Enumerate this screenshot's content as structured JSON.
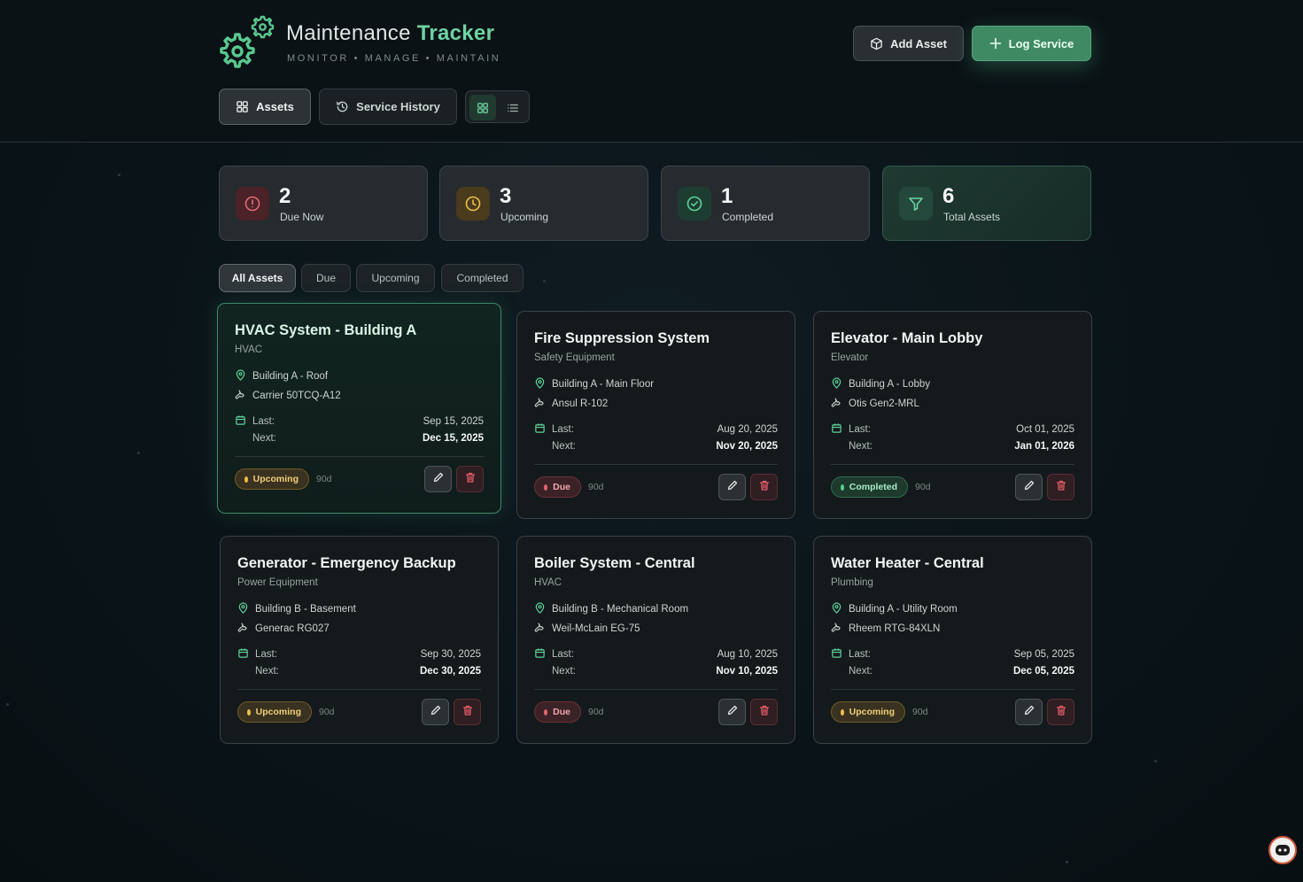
{
  "header": {
    "title_main": "Maintenance",
    "title_accent": "Tracker",
    "subtitle": "MONITOR • MANAGE • MAINTAIN",
    "add_asset_label": "Add Asset",
    "log_service_label": "Log Service"
  },
  "nav": {
    "assets_label": "Assets",
    "history_label": "Service History"
  },
  "stats": {
    "due_now": {
      "value": "2",
      "label": "Due Now"
    },
    "upcoming": {
      "value": "3",
      "label": "Upcoming"
    },
    "completed": {
      "value": "1",
      "label": "Completed"
    },
    "total": {
      "value": "6",
      "label": "Total Assets"
    }
  },
  "filters": [
    "All Assets",
    "Due",
    "Upcoming",
    "Completed"
  ],
  "labels": {
    "last": "Last:",
    "next": "Next:"
  },
  "assets": [
    {
      "name": "HVAC System - Building A",
      "category": "HVAC",
      "location": "Building A - Roof",
      "model": "Carrier 50TCQ-A12",
      "last": "Sep 15, 2025",
      "next": "Dec 15, 2025",
      "status": "Upcoming",
      "interval": "90d"
    },
    {
      "name": "Fire Suppression System",
      "category": "Safety Equipment",
      "location": "Building A - Main Floor",
      "model": "Ansul R-102",
      "last": "Aug 20, 2025",
      "next": "Nov 20, 2025",
      "status": "Due",
      "interval": "90d"
    },
    {
      "name": "Elevator - Main Lobby",
      "category": "Elevator",
      "location": "Building A - Lobby",
      "model": "Otis Gen2-MRL",
      "last": "Oct 01, 2025",
      "next": "Jan 01, 2026",
      "status": "Completed",
      "interval": "90d"
    },
    {
      "name": "Generator - Emergency Backup",
      "category": "Power Equipment",
      "location": "Building B - Basement",
      "model": "Generac RG027",
      "last": "Sep 30, 2025",
      "next": "Dec 30, 2025",
      "status": "Upcoming",
      "interval": "90d"
    },
    {
      "name": "Boiler System - Central",
      "category": "HVAC",
      "location": "Building B - Mechanical Room",
      "model": "Weil-McLain EG-75",
      "last": "Aug 10, 2025",
      "next": "Nov 10, 2025",
      "status": "Due",
      "interval": "90d"
    },
    {
      "name": "Water Heater - Central",
      "category": "Plumbing",
      "location": "Building A - Utility Room",
      "model": "Rheem RTG-84XLN",
      "last": "Sep 05, 2025",
      "next": "Dec 05, 2025",
      "status": "Upcoming",
      "interval": "90d"
    }
  ],
  "colors": {
    "accent": "#6fd3a2",
    "due": "#e3636e",
    "upcoming": "#f0bf4a",
    "completed": "#4fd18a"
  },
  "icons": {
    "logo": "gear-icon",
    "add": "cube-icon",
    "log": "plus-icon",
    "location": "map-pin-icon",
    "model": "wrench-icon",
    "date": "calendar-icon",
    "edit": "pencil-icon",
    "delete": "trash-icon"
  }
}
